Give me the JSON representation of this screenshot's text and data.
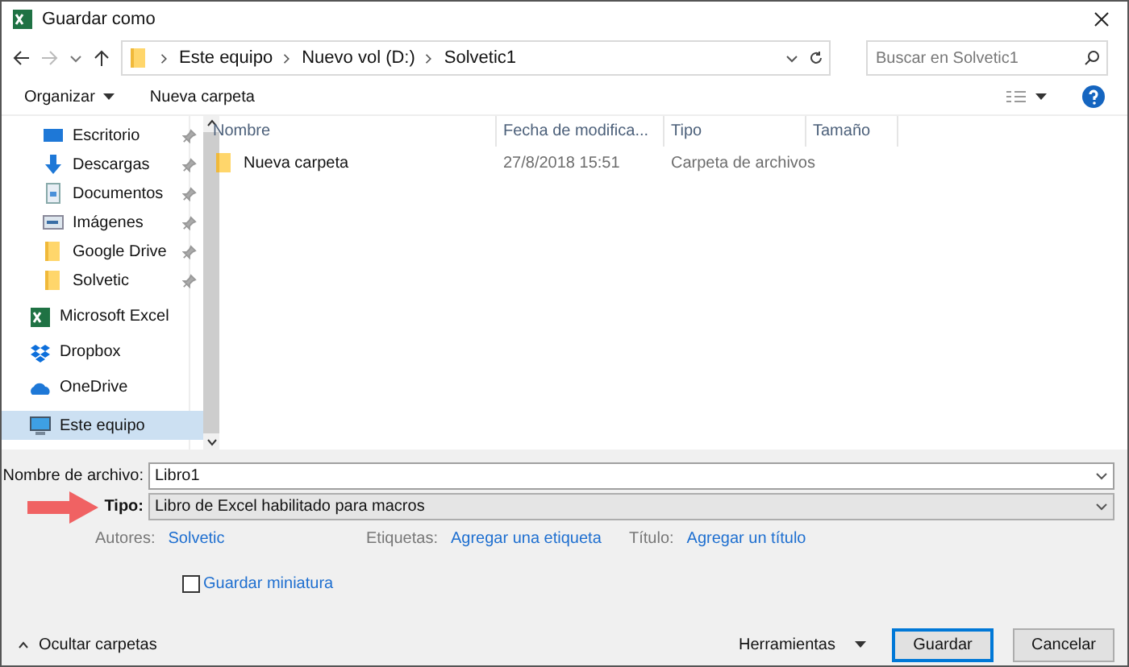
{
  "window": {
    "title": "Guardar como"
  },
  "address": {
    "crumbs": [
      "Este equipo",
      "Nuevo vol (D:)",
      "Solvetic1"
    ]
  },
  "search": {
    "placeholder": "Buscar en Solvetic1"
  },
  "toolbar": {
    "organize": "Organizar",
    "new_folder": "Nueva carpeta"
  },
  "sidebar": {
    "items": [
      {
        "label": "Escritorio",
        "kind": "desktop",
        "pinned": true,
        "selected": false
      },
      {
        "label": "Descargas",
        "kind": "download",
        "pinned": true,
        "selected": false
      },
      {
        "label": "Documentos",
        "kind": "documents",
        "pinned": true,
        "selected": false
      },
      {
        "label": "Imágenes",
        "kind": "pictures",
        "pinned": true,
        "selected": false
      },
      {
        "label": "Google Drive",
        "kind": "folder",
        "pinned": true,
        "selected": false
      },
      {
        "label": "Solvetic",
        "kind": "folder",
        "pinned": true,
        "selected": false
      },
      {
        "label": "Microsoft Excel",
        "kind": "excel",
        "pinned": false,
        "selected": false
      },
      {
        "label": "Dropbox",
        "kind": "dropbox",
        "pinned": false,
        "selected": false
      },
      {
        "label": "OneDrive",
        "kind": "cloud",
        "pinned": false,
        "selected": false
      },
      {
        "label": "Este equipo",
        "kind": "computer",
        "pinned": false,
        "selected": true
      }
    ]
  },
  "table": {
    "columns": [
      "Nombre",
      "Fecha de modifica...",
      "Tipo",
      "Tamaño"
    ],
    "rows": [
      {
        "name": "Nueva carpeta",
        "date": "27/8/2018 15:51",
        "type": "Carpeta de archivos"
      }
    ]
  },
  "form": {
    "filename_label": "Nombre de archivo:",
    "filename": "Libro1",
    "type_label": "Tipo:",
    "type": "Libro de Excel habilitado para macros",
    "meta": [
      {
        "label": "Autores:",
        "value": "Solvetic"
      },
      {
        "label": "Etiquetas:",
        "value": "Agregar una etiqueta"
      },
      {
        "label": "Título:",
        "value": "Agregar un título"
      }
    ],
    "thumbnail": {
      "label": "Guardar miniatura",
      "checked": false
    }
  },
  "footer": {
    "hide_folders": "Ocultar carpetas",
    "tools": "Herramientas",
    "buttons": [
      "Guardar",
      "Cancelar"
    ]
  }
}
